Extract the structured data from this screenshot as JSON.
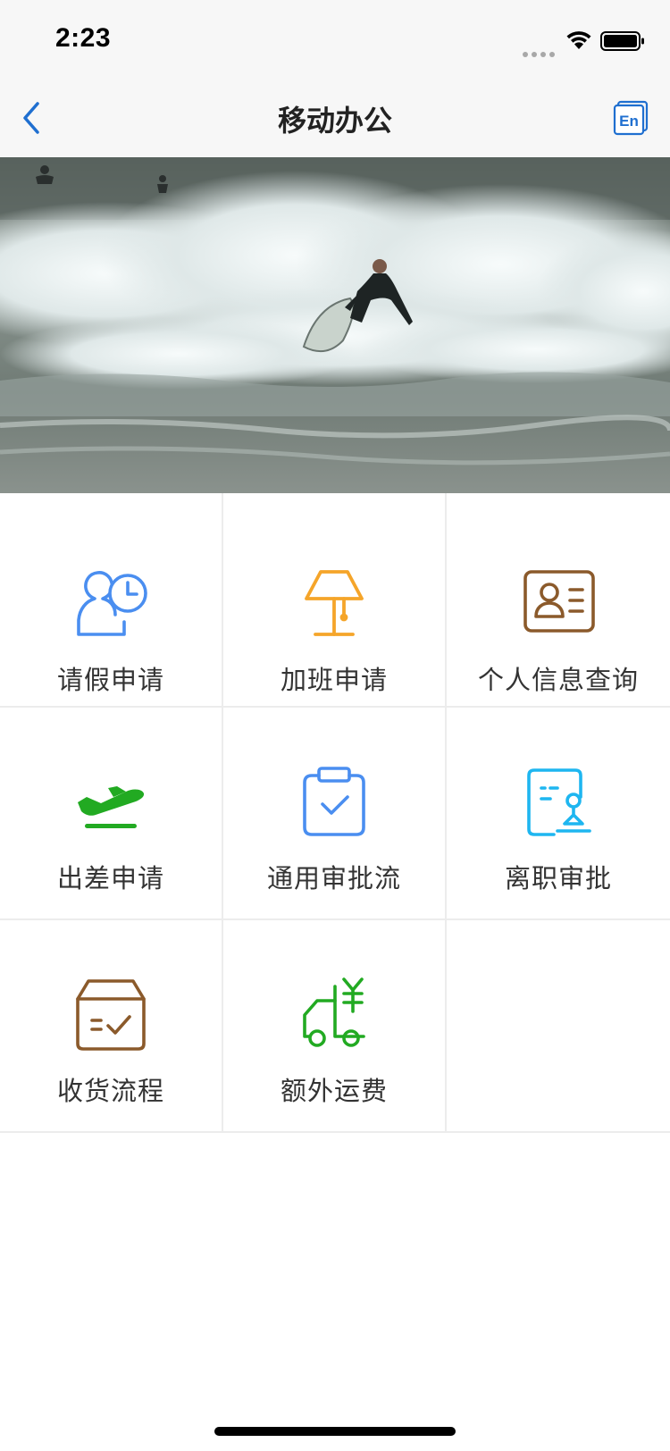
{
  "status_bar": {
    "time": "2:23"
  },
  "nav": {
    "title": "移动办公",
    "lang_button": "En"
  },
  "menu": [
    {
      "label": "请假申请",
      "icon": "leave-clock-user-icon",
      "color": "#4a8ef0"
    },
    {
      "label": "加班申请",
      "icon": "desk-lamp-icon",
      "color": "#f5a52a"
    },
    {
      "label": "个人信息查询",
      "icon": "id-card-icon",
      "color": "#8b5a2b"
    },
    {
      "label": "出差申请",
      "icon": "airplane-takeoff-icon",
      "color": "#22aa22"
    },
    {
      "label": "通用审批流",
      "icon": "clipboard-check-icon",
      "color": "#4a8ef0"
    },
    {
      "label": "离职审批",
      "icon": "document-stamp-icon",
      "color": "#1eb6f0"
    },
    {
      "label": "收货流程",
      "icon": "package-check-icon",
      "color": "#8b5a2b"
    },
    {
      "label": "额外运费",
      "icon": "delivery-truck-yen-icon",
      "color": "#22aa22"
    }
  ]
}
